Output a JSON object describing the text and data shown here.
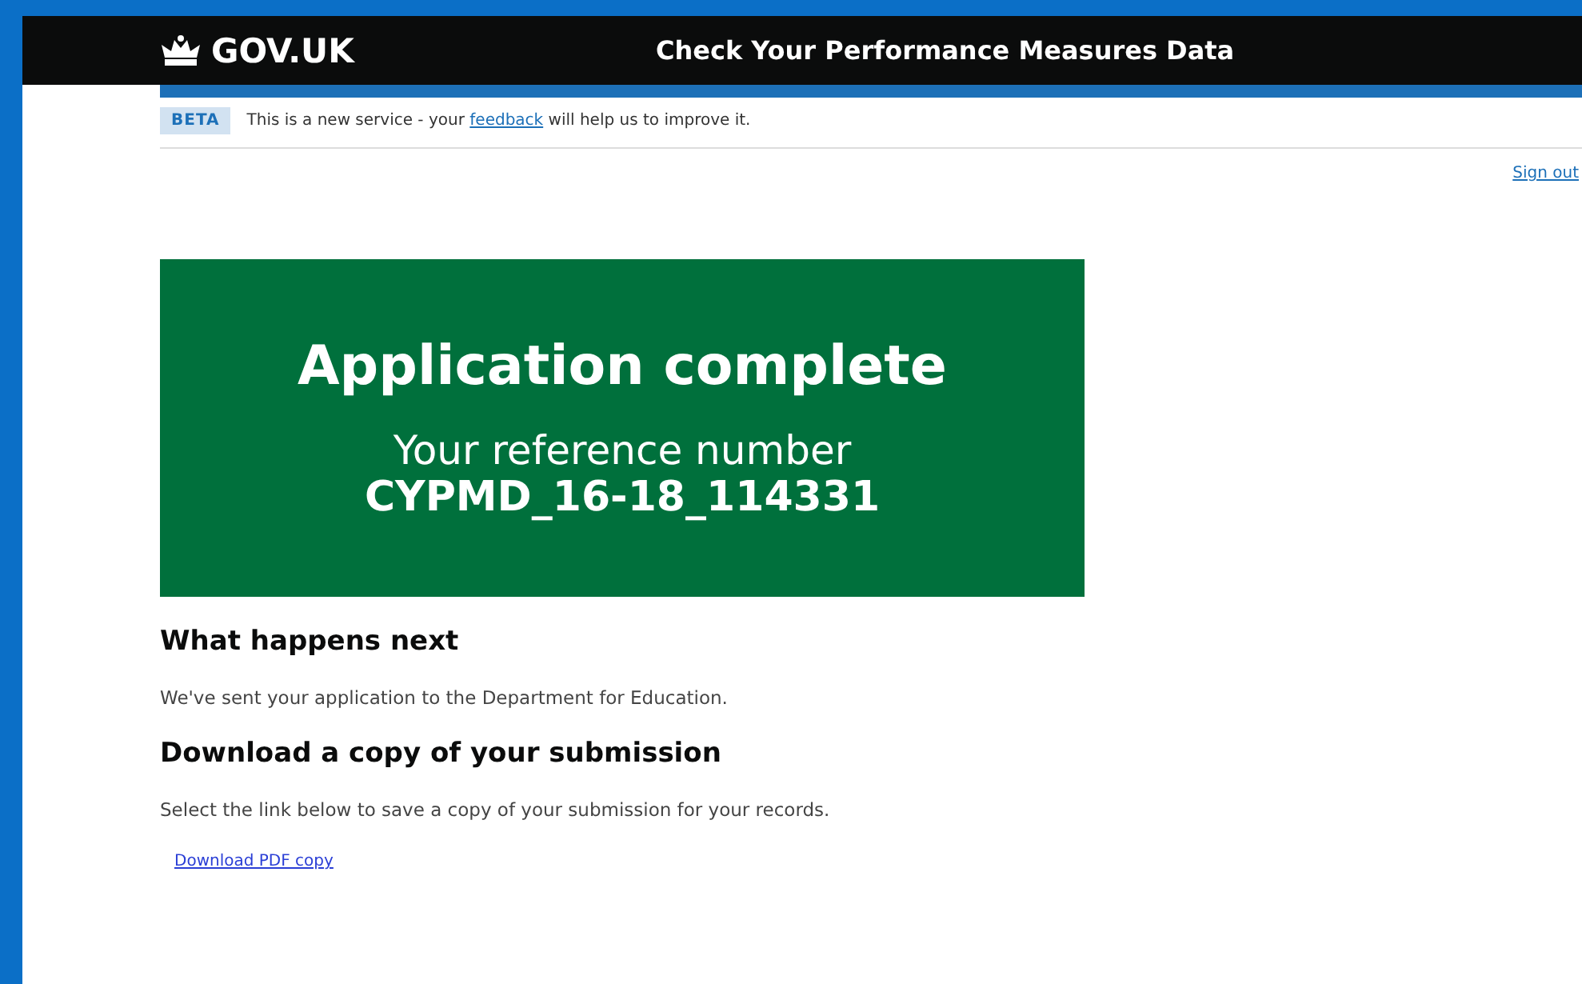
{
  "header": {
    "logo": "GOV.UK",
    "service_name": "Check Your Performance Measures Data"
  },
  "phase_banner": {
    "tag": "BETA",
    "text_before": "This is a new service - your",
    "link": "feedback",
    "text_after": "will help us to improve it."
  },
  "sign_out": "Sign out",
  "panel": {
    "title": "Application complete",
    "subtitle": "Your reference number",
    "reference": "CYPMD_16-18_114331"
  },
  "sections": [
    {
      "heading": "What happens next",
      "body": "We've sent your application to the Department for Education."
    },
    {
      "heading": "Download a copy of your submission",
      "body": "Select the link below to save a copy of your submission for your records.",
      "link": "Download PDF copy"
    }
  ]
}
